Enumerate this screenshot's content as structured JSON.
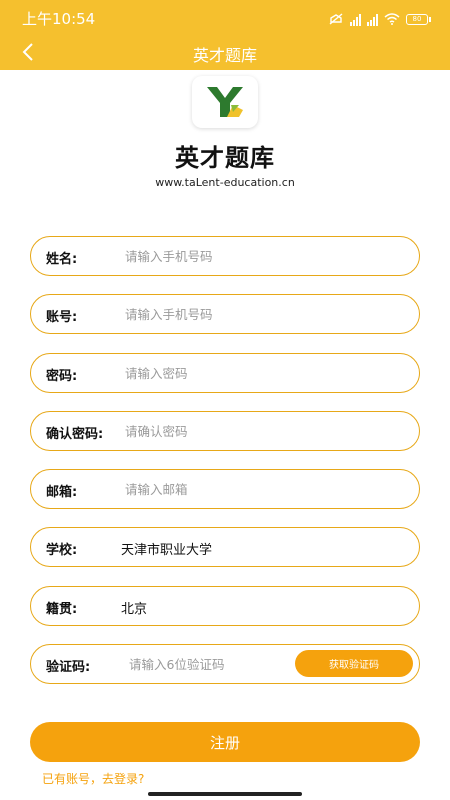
{
  "status_bar": {
    "time": "上午10:54",
    "icons": [
      "silent-icon",
      "hd-signal-icon",
      "hd-signal-icon",
      "wifi-icon",
      "battery-icon"
    ],
    "battery": "80"
  },
  "nav": {
    "title": "英才题库",
    "back_icon": "chevron-left-icon"
  },
  "header": {
    "app_name": "英才题库",
    "website": "www.taLent-education.cn"
  },
  "form": {
    "name": {
      "label": "姓名:",
      "placeholder": "请输入手机号码"
    },
    "account": {
      "label": "账号:",
      "placeholder": "请输入手机号码"
    },
    "password": {
      "label": "密码:",
      "placeholder": "请输入密码"
    },
    "confirm_password": {
      "label": "确认密码:",
      "placeholder": "请确认密码"
    },
    "email": {
      "label": "邮箱:",
      "placeholder": "请输入邮箱"
    },
    "school": {
      "label": "学校:",
      "value": "天津市职业大学"
    },
    "hometown": {
      "label": "籍贯:",
      "value": "北京"
    },
    "code": {
      "label": "验证码:",
      "placeholder": "请输入6位验证码",
      "button_label": "获取验证码"
    }
  },
  "actions": {
    "register_label": "注册",
    "login_link": "已有账号，去登录?"
  },
  "colors": {
    "header_bg": "#f5c02e",
    "accent": "#f5a20d",
    "field_border": "#e7a818"
  }
}
